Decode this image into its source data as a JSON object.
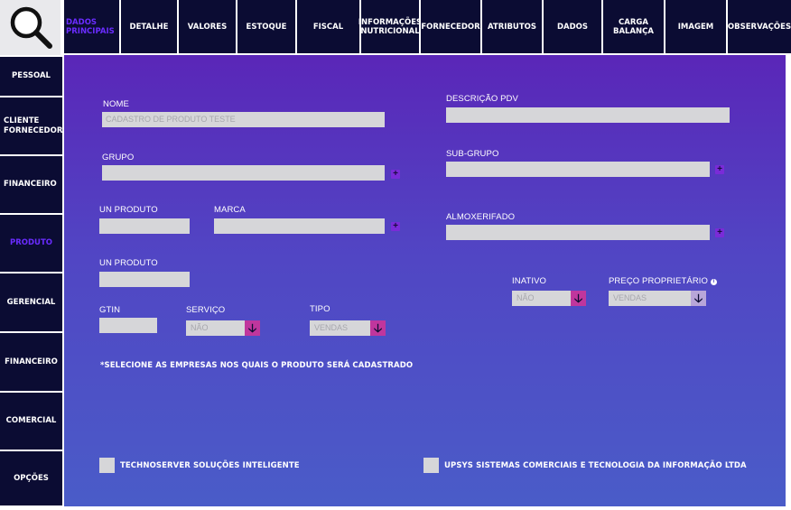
{
  "tabs": [
    {
      "label": "DADOS PRINCIPAIS"
    },
    {
      "label": "DETALHE"
    },
    {
      "label": "VALORES"
    },
    {
      "label": "ESTOQUE"
    },
    {
      "label": "FISCAL"
    },
    {
      "label": "INFORMAÇÕES NUTRICIONAL"
    },
    {
      "label": "FORNECEDOR"
    },
    {
      "label": "ATRIBUTOS"
    },
    {
      "label": "DADOS"
    },
    {
      "label": "CARGA BALANÇA"
    },
    {
      "label": "IMAGEM"
    },
    {
      "label": "OBSERVAÇÕES"
    }
  ],
  "sidebar": {
    "items": [
      {
        "label": "PESSOAL"
      },
      {
        "label": "CLIENTE FORNECEDOR"
      },
      {
        "label": "FINANCEIRO"
      },
      {
        "label": "PRODUTO"
      },
      {
        "label": "GERENCIAL"
      },
      {
        "label": "FINANCEIRO"
      },
      {
        "label": "COMERCIAL"
      },
      {
        "label": "OPÇÕES"
      }
    ]
  },
  "form": {
    "nome": {
      "label": "NOME",
      "value": "CADASTRO  DE PRODUTO TESTE"
    },
    "descricao_pdv": {
      "label": "DESCRIÇÃO PDV",
      "value": ""
    },
    "grupo": {
      "label": "GRUPO",
      "value": ""
    },
    "sub_grupo": {
      "label": "SUB-GRUPO",
      "value": ""
    },
    "un_produto": {
      "label": "UN PRODUTO",
      "value": ""
    },
    "marca": {
      "label": "MARCA",
      "value": ""
    },
    "almoxerifado": {
      "label": "ALMOXERIFADO",
      "value": ""
    },
    "un_produto_2": {
      "label": "UN PRODUTO",
      "value": ""
    },
    "inativo": {
      "label": "INATIVO",
      "value": "NÃO"
    },
    "preco_proprietario": {
      "label": "PREÇO PROPRIETÁRIO",
      "value": "VENDAS"
    },
    "gtin": {
      "label": "GTIN",
      "value": ""
    },
    "servico": {
      "label": "SERVIÇO",
      "value": "NÃO"
    },
    "tipo": {
      "label": "TIPO",
      "value": "VENDAS"
    },
    "plus_symbol": "+",
    "arrow_symbol": "🡣",
    "info_symbol": "i"
  },
  "companies": {
    "note": "*SELECIONE AS EMPRESAS  NOS QUAIS  O PRODUTO SERÁ CADASTRADO",
    "list": [
      {
        "name": "TECHNOSERVER SOLUÇÕES INTELIGENTE"
      },
      {
        "name": "UPSYS SISTEMAS COMERCIAIS E TECNOLOGIA DA INFORMAÇÃO LTDA"
      }
    ]
  },
  "icons": {
    "search": "search-icon"
  },
  "colors": {
    "nav_bg": "#0b0c33",
    "active_text": "#6a2cff",
    "dropdown_accent": "#c0369d",
    "gradient_top": "#5a26b8",
    "gradient_bottom": "#4a5cc8"
  }
}
